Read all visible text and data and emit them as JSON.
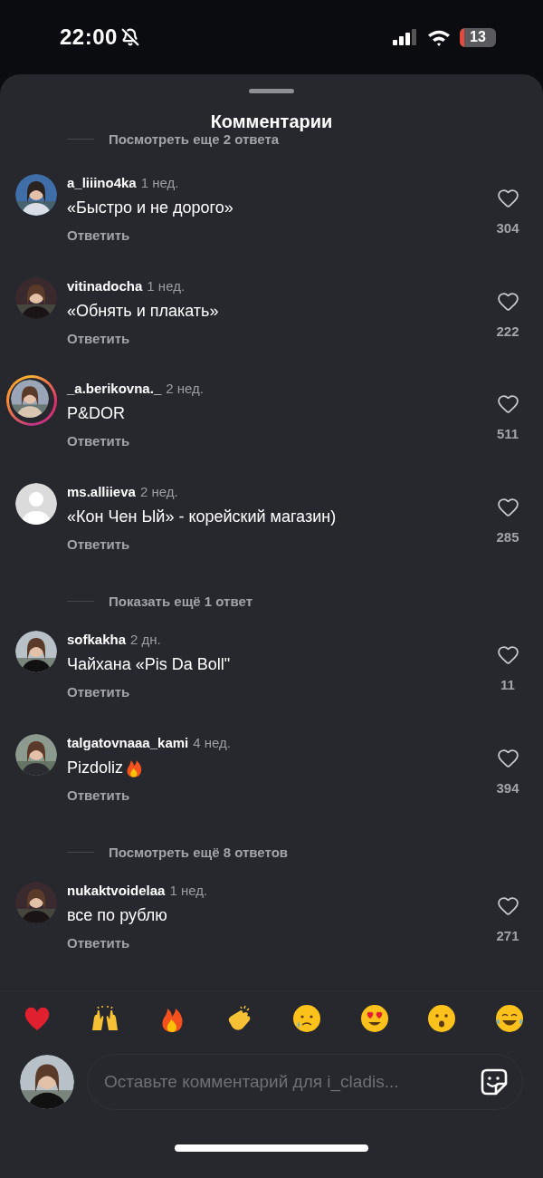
{
  "status_bar": {
    "time": "22:00",
    "battery": "13"
  },
  "sheet": {
    "title": "Комментарии"
  },
  "items": [
    {
      "kind": "more",
      "label": "Посмотреть еще 2 ответа"
    },
    {
      "kind": "comment",
      "user": "a_liiino4ka",
      "age": "1 нед.",
      "text": "«Быстро и не дорого»",
      "reply": "Ответить",
      "likes": "304",
      "avatar": {
        "kind": "picture",
        "ring": false
      }
    },
    {
      "kind": "comment",
      "user": "vitinadocha",
      "age": "1 нед.",
      "text": "«Обнять и плакать»",
      "reply": "Ответить",
      "likes": "222",
      "avatar": {
        "kind": "picture",
        "ring": false
      }
    },
    {
      "kind": "comment",
      "user": "_a.berikovna._",
      "age": "2 нед.",
      "text": "P&DOR",
      "reply": "Ответить",
      "likes": "511",
      "avatar": {
        "kind": "picture",
        "ring": true
      }
    },
    {
      "kind": "comment",
      "user": "ms.alliieva",
      "age": "2 нед.",
      "text": "«Кон Чен Ый» - корейский магазин)",
      "reply": "Ответить",
      "likes": "285",
      "avatar": {
        "kind": "placeholder",
        "ring": false
      }
    },
    {
      "kind": "more",
      "label": "Показать ещё 1 ответ"
    },
    {
      "kind": "comment",
      "user": "sofkakha",
      "age": "2 дн.",
      "text": "Чайхана «Pis Da Boll\"",
      "reply": "Ответить",
      "likes": "11",
      "avatar": {
        "kind": "picture",
        "ring": false
      }
    },
    {
      "kind": "comment",
      "user": "talgatovnaaa_kami",
      "age": "4 нед.",
      "text": "Pizdoliz",
      "emoji": {
        "kind": "fire"
      },
      "reply": "Ответить",
      "likes": "394",
      "avatar": {
        "kind": "picture",
        "ring": false
      }
    },
    {
      "kind": "more",
      "label": "Посмотреть ещё 8 ответов"
    },
    {
      "kind": "comment",
      "user": "nukaktvoidelaa",
      "age": "1 нед.",
      "text": "все по рублю",
      "reply": "Ответить",
      "likes": "271",
      "avatar": {
        "kind": "picture",
        "ring": false
      }
    }
  ],
  "reactions": [
    {
      "kind": "heart"
    },
    {
      "kind": "raised-hands"
    },
    {
      "kind": "fire"
    },
    {
      "kind": "clap"
    },
    {
      "kind": "crying"
    },
    {
      "kind": "heart-eyes"
    },
    {
      "kind": "surprised"
    },
    {
      "kind": "laughing"
    }
  ],
  "composer": {
    "placeholder": "Оставьте комментарий для i_cladis..."
  }
}
